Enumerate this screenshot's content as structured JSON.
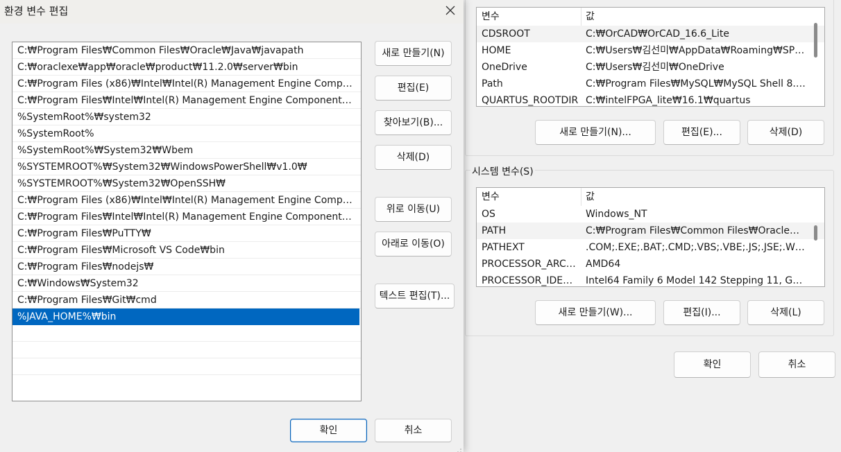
{
  "env_dialog": {
    "user_vars": {
      "columns": [
        "변수",
        "값"
      ],
      "rows": [
        {
          "name": "CDSROOT",
          "value": "C:₩OrCAD₩OrCAD_16.6_Lite"
        },
        {
          "name": "HOME",
          "value": "C:₩Users₩김선미₩AppData₩Roaming₩SPB_..."
        },
        {
          "name": "OneDrive",
          "value": "C:₩Users₩김선미₩OneDrive"
        },
        {
          "name": "Path",
          "value": "C:₩Program Files₩MySQL₩MySQL Shell 8.0₩..."
        },
        {
          "name": "QUARTUS_ROOTDIR",
          "value": "C:₩intelFPGA_lite₩16.1₩quartus"
        }
      ],
      "buttons": {
        "new": "새로 만들기(N)...",
        "edit": "편집(E)...",
        "delete": "삭제(D)"
      }
    },
    "system_vars": {
      "title": "시스템 변수(S)",
      "columns": [
        "변수",
        "값"
      ],
      "rows": [
        {
          "name": "OS",
          "value": "Windows_NT"
        },
        {
          "name": "PATH",
          "value": "C:₩Program Files₩Common Files₩Oracle₩Ja..."
        },
        {
          "name": "PATHEXT",
          "value": ".COM;.EXE;.BAT;.CMD;.VBS;.VBE;.JS;.JSE;.WSF;..."
        },
        {
          "name": "PROCESSOR_ARCH...",
          "value": "AMD64"
        },
        {
          "name": "PROCESSOR_IDENT...",
          "value": "Intel64 Family 6 Model 142 Stepping 11, Gen..."
        }
      ],
      "buttons": {
        "new": "새로 만들기(W)...",
        "edit": "편집(I)...",
        "delete": "삭제(L)"
      }
    },
    "ok": "확인",
    "cancel": "취소"
  },
  "edit_dialog": {
    "title": "환경 변수 편집",
    "close_icon": "close-icon",
    "paths": [
      "C:₩Program Files₩Common Files₩Oracle₩Java₩javapath",
      "C:₩oraclexe₩app₩oracle₩product₩11.2.0₩server₩bin",
      "C:₩Program Files (x86)₩Intel₩Intel(R) Management Engine Compone...",
      "C:₩Program Files₩Intel₩Intel(R) Management Engine Components₩iC...",
      "%SystemRoot%₩system32",
      "%SystemRoot%",
      "%SystemRoot%₩System32₩Wbem",
      "%SYSTEMROOT%₩System32₩WindowsPowerShell₩v1.0₩",
      "%SYSTEMROOT%₩System32₩OpenSSH₩",
      "C:₩Program Files (x86)₩Intel₩Intel(R) Management Engine Compone...",
      "C:₩Program Files₩Intel₩Intel(R) Management Engine Components₩D...",
      "C:₩Program Files₩PuTTY₩",
      "C:₩Program Files₩Microsoft VS Code₩bin",
      "C:₩Program Files₩nodejs₩",
      "C:₩Windows₩System32",
      "C:₩Program Files₩Git₩cmd",
      "%JAVA_HOME%₩bin"
    ],
    "buttons": {
      "new": "새로 만들기(N)",
      "edit": "편집(E)",
      "browse": "찾아보기(B)...",
      "delete": "삭제(D)",
      "move_up": "위로 이동(U)",
      "move_down": "아래로 이동(O)",
      "edit_text": "텍스트 편집(T)..."
    },
    "ok": "확인",
    "cancel": "취소"
  },
  "colors": {
    "selection": "#0067c0",
    "primary_border": "#005fb8"
  }
}
